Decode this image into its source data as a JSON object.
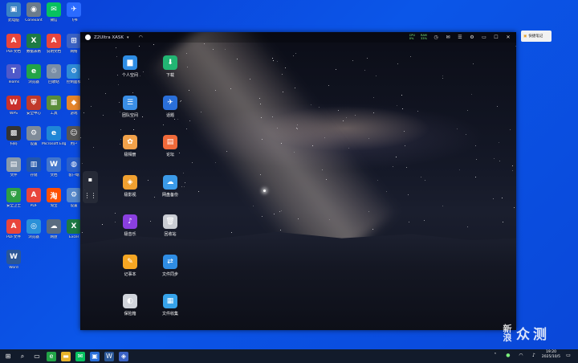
{
  "desktop": {
    "icons": [
      {
        "label": "此电脑",
        "color": "#3b82c4",
        "glyph": "▣"
      },
      {
        "label": "Conexant",
        "color": "#6b7b8c",
        "glyph": "◉"
      },
      {
        "label": "微信",
        "color": "#07c160",
        "glyph": "✉"
      },
      {
        "label": "飞书",
        "color": "#2b6bff",
        "glyph": "✈"
      },
      {
        "label": "PDF文档",
        "color": "#e8453c",
        "glyph": "A"
      },
      {
        "label": "数据表格",
        "color": "#1d7a44",
        "glyph": "X"
      },
      {
        "label": "说明文档",
        "color": "#e8453c",
        "glyph": "A"
      },
      {
        "label": "网络",
        "color": "#3b62c4",
        "glyph": "⊞"
      },
      {
        "label": "Teams",
        "color": "#5059c9",
        "glyph": "T"
      },
      {
        "label": "浏览器",
        "color": "#22a447",
        "glyph": "e"
      },
      {
        "label": "回收站",
        "color": "#7a8ea6",
        "glyph": "♲"
      },
      {
        "label": "控制面板",
        "color": "#2f8bd6",
        "glyph": "⚙"
      },
      {
        "label": "WPS",
        "color": "#c9302c",
        "glyph": "W"
      },
      {
        "label": "安全中心",
        "color": "#c0392b",
        "glyph": "⛨"
      },
      {
        "label": "工具",
        "color": "#5a8d3a",
        "glyph": "▦"
      },
      {
        "label": "游戏",
        "color": "#e6852a",
        "glyph": "◆"
      },
      {
        "label": "扫码",
        "color": "#333333",
        "glyph": "▩"
      },
      {
        "label": "设置",
        "color": "#7e8a99",
        "glyph": "⚙"
      },
      {
        "label": "Microsoft Edge",
        "color": "#1f86d6",
        "glyph": "e"
      },
      {
        "label": "用户",
        "color": "#555555",
        "glyph": "☺"
      },
      {
        "label": "文件",
        "color": "#8899aa",
        "glyph": "▤"
      },
      {
        "label": "存储",
        "color": "#2255aa",
        "glyph": "▥"
      },
      {
        "label": "文档",
        "color": "#4477cc",
        "glyph": "W"
      },
      {
        "label": "客户端",
        "color": "#2a5fc9",
        "glyph": "◍"
      },
      {
        "label": "安全卫士",
        "color": "#2f9e44",
        "glyph": "⛨"
      },
      {
        "label": "PDF",
        "color": "#e8453c",
        "glyph": "A"
      },
      {
        "label": "淘宝",
        "color": "#ff5000",
        "glyph": "淘"
      },
      {
        "label": "设置",
        "color": "#5588cc",
        "glyph": "⚙"
      },
      {
        "label": "PDF文件",
        "color": "#e8453c",
        "glyph": "A"
      },
      {
        "label": "浏览器",
        "color": "#2a90d8",
        "glyph": "◎"
      },
      {
        "label": "网盘",
        "color": "#5a6c80",
        "glyph": "☁"
      },
      {
        "label": "Excel",
        "color": "#1d7a44",
        "glyph": "X"
      },
      {
        "label": "Word",
        "color": "#2b5797",
        "glyph": "W"
      }
    ]
  },
  "nas": {
    "title": "Z2Ultra XASK",
    "stats": [
      {
        "name": "CPU",
        "value": "0%"
      },
      {
        "name": "RAM",
        "value": "33%"
      }
    ],
    "apps": [
      {
        "label": "个人空间",
        "color": "#2f8de4",
        "glyph": "▆"
      },
      {
        "label": "下载",
        "color": "#22b573",
        "glyph": "⬇"
      },
      {
        "label": "团队空间",
        "color": "#3a8ee6",
        "glyph": "☰"
      },
      {
        "label": "话题",
        "color": "#2a6fd9",
        "glyph": "✈"
      },
      {
        "label": "极相册",
        "color": "#f1a14a",
        "glyph": "✿"
      },
      {
        "label": "论坛",
        "color": "#f06a3a",
        "glyph": "▤"
      },
      {
        "label": "极影视",
        "color": "#f0a030",
        "glyph": "◈"
      },
      {
        "label": "网盘备份",
        "color": "#3b9ae8",
        "glyph": "☁"
      },
      {
        "label": "极音乐",
        "color": "#8a3fe0",
        "glyph": "♪"
      },
      {
        "label": "回收站",
        "color": "#c9ccd3",
        "glyph": "🗑"
      },
      {
        "label": "记事本",
        "color": "#f5a623",
        "glyph": "✎"
      },
      {
        "label": "文件同步",
        "color": "#2f8de4",
        "glyph": "⇄"
      },
      {
        "label": "保险箱",
        "color": "#d0d4db",
        "glyph": "◐"
      },
      {
        "label": "文件收集",
        "color": "#36a3ea",
        "glyph": "▦"
      }
    ]
  },
  "notes_widget": {
    "label": "快捷笔记"
  },
  "taskbar": {
    "clock_time": "19:20",
    "clock_date": "2025/10/5"
  },
  "watermark": {
    "text": "新浪众测",
    "char1": "新",
    "char2": "浪",
    "char3": "众",
    "char4": "测"
  }
}
